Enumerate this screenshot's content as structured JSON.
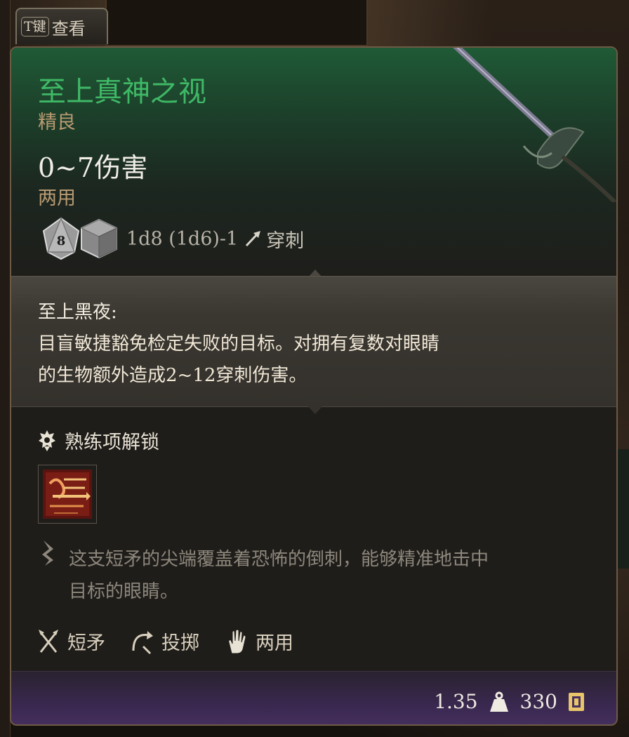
{
  "t_tab": {
    "key": "T键",
    "label": "查看"
  },
  "item": {
    "name": "至上真神之视",
    "rarity": "精良",
    "damage": "0~7伤害",
    "handedness": "两用",
    "dice_formula": "1d8 (1d6)-1",
    "damage_type": "穿刺",
    "dice_faces": [
      "8",
      ""
    ]
  },
  "special": {
    "title": "至上黑夜:",
    "description_line1": "目盲敏捷豁免检定失败的目标。对拥有复数对眼睛",
    "description_line2": "的生物额外造成2~12穿刺伤害。"
  },
  "proficiency": {
    "label": "熟练项解锁"
  },
  "lore": {
    "line1": "这支短矛的尖端覆盖着恐怖的倒刺，能够精准地击中",
    "line2": "目标的眼睛。"
  },
  "tags": [
    {
      "icon": "crossed-spears-icon",
      "label": "短矛"
    },
    {
      "icon": "throw-arc-icon",
      "label": "投掷"
    },
    {
      "icon": "open-hand-icon",
      "label": "两用"
    }
  ],
  "footer": {
    "weight": "1.35",
    "gold": "330"
  },
  "colors": {
    "item_name": "#3fb866",
    "rarity": "#b89a72",
    "footer_purple": "#46305e",
    "header_green": "#1f5a36"
  }
}
